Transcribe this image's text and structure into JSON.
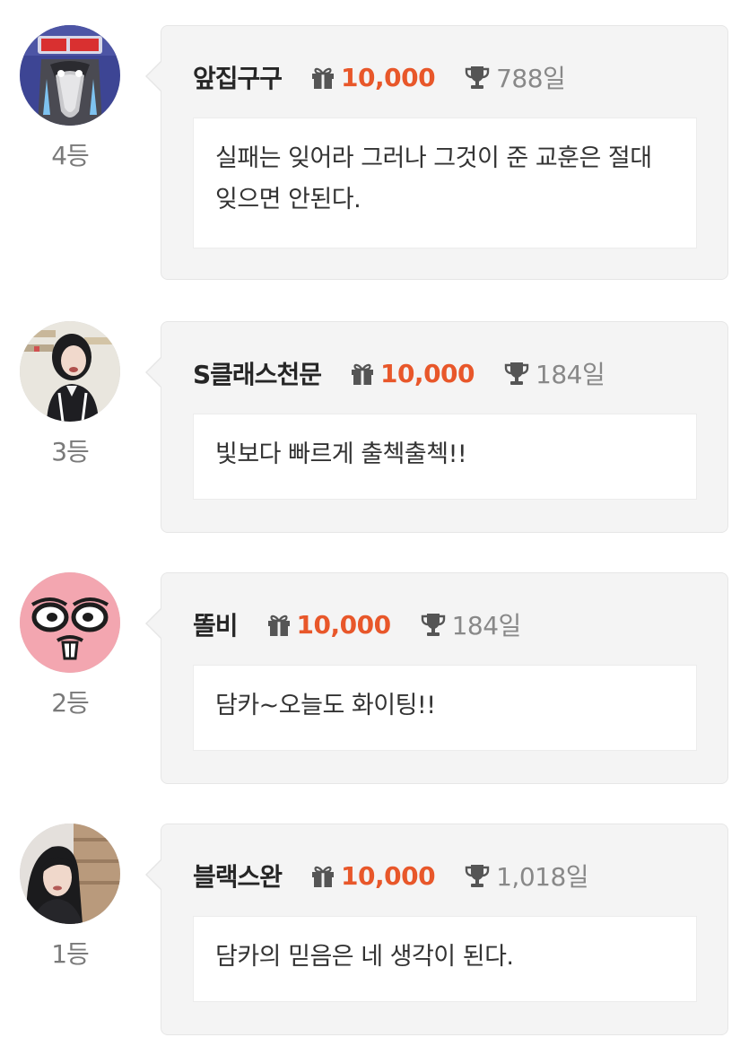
{
  "entries": [
    {
      "avatar_icon": "crying-character-avatar",
      "rank": "4등",
      "nickname": "앞집구구",
      "gift_icon": "gift-icon",
      "gift_amount": "10,000",
      "trophy_icon": "trophy-icon",
      "days": "788일",
      "message": "실패는 잊어라 그러나 그것이 준 교훈은 절대 잊으면 안된다."
    },
    {
      "avatar_icon": "woman-photo-avatar",
      "rank": "3등",
      "nickname": "S클래스천문",
      "gift_icon": "gift-icon",
      "gift_amount": "10,000",
      "trophy_icon": "trophy-icon",
      "days": "184일",
      "message": "빛보다 빠르게 출첵출첵!!"
    },
    {
      "avatar_icon": "pink-face-avatar",
      "rank": "2등",
      "nickname": "똘비",
      "gift_icon": "gift-icon",
      "gift_amount": "10,000",
      "trophy_icon": "trophy-icon",
      "days": "184일",
      "message": "담카~오늘도 화이팅!!"
    },
    {
      "avatar_icon": "portrait-photo-avatar",
      "rank": "1등",
      "nickname": "블랙스완",
      "gift_icon": "gift-icon",
      "gift_amount": "10,000",
      "trophy_icon": "trophy-icon",
      "days": "1,018일",
      "message": "담카의 믿음은 네 생각이 된다."
    }
  ],
  "colors": {
    "accent_orange": "#e8572a",
    "card_bg": "#f4f4f4",
    "muted_text": "#888888",
    "rank_text": "#7a7a7a"
  }
}
